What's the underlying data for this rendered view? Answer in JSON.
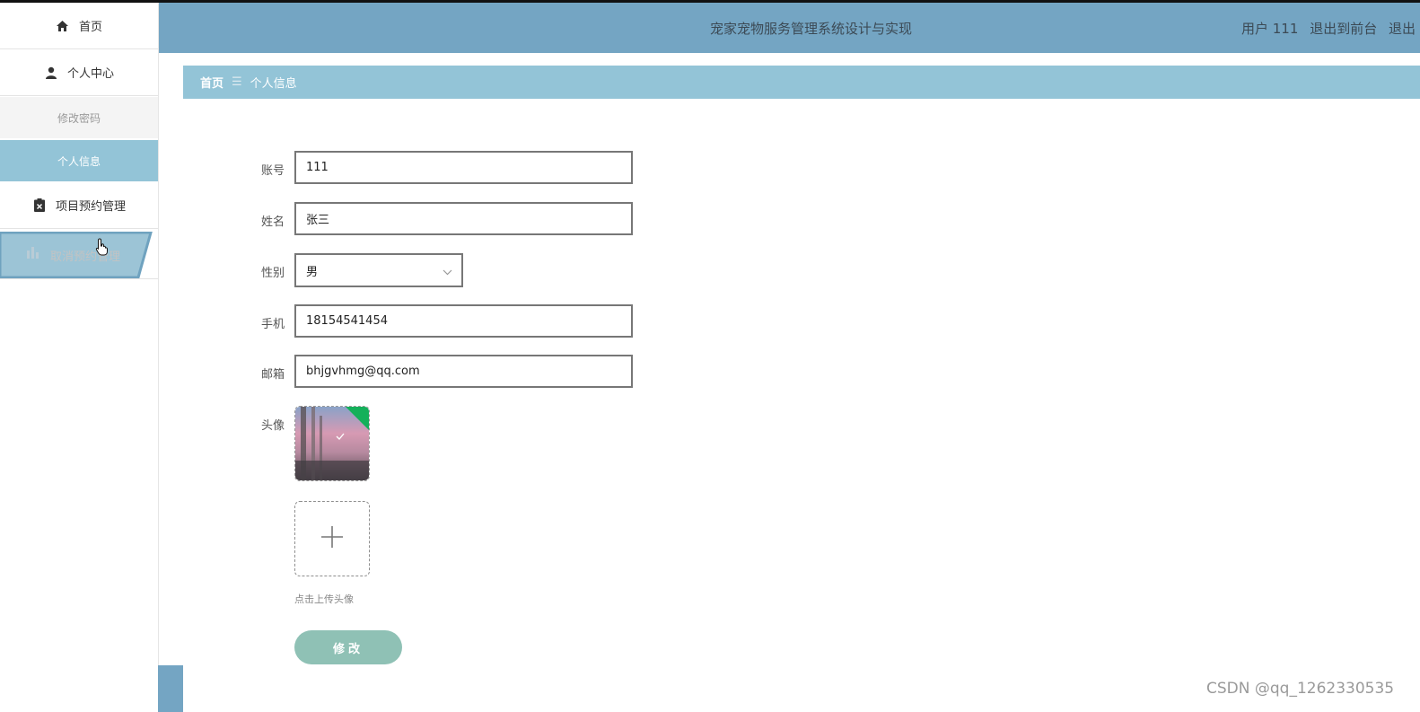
{
  "header": {
    "title": "宠家宠物服务管理系统设计与实现",
    "user_label": "用户 111",
    "front_link": "退出到前台",
    "logout_link": "退出"
  },
  "sidebar": {
    "items": [
      {
        "label": "首页",
        "icon": "home-icon"
      },
      {
        "label": "个人中心",
        "icon": "user-icon"
      },
      {
        "label": "修改密码"
      },
      {
        "label": "个人信息"
      },
      {
        "label": "项目预约管理",
        "icon": "clipboard-icon"
      },
      {
        "label": "取消预约管理",
        "icon": "chart-icon"
      }
    ]
  },
  "breadcrumb": {
    "home": "首页",
    "separator": "☰",
    "current": "个人信息"
  },
  "form": {
    "account_label": "账号",
    "account_value": "111",
    "name_label": "姓名",
    "name_value": "张三",
    "gender_label": "性别",
    "gender_value": "男",
    "phone_label": "手机",
    "phone_value": "18154541454",
    "email_label": "邮箱",
    "email_value": "bhjgvhmg@qq.com",
    "avatar_label": "头像",
    "upload_tip": "点击上传头像",
    "submit_label": "修改"
  },
  "watermark": "CSDN @qq_1262330535",
  "colors": {
    "header_bg": "#74a5c3",
    "breadcrumb_bg": "#93c4d7",
    "submit_bg": "#8fc1b5"
  }
}
